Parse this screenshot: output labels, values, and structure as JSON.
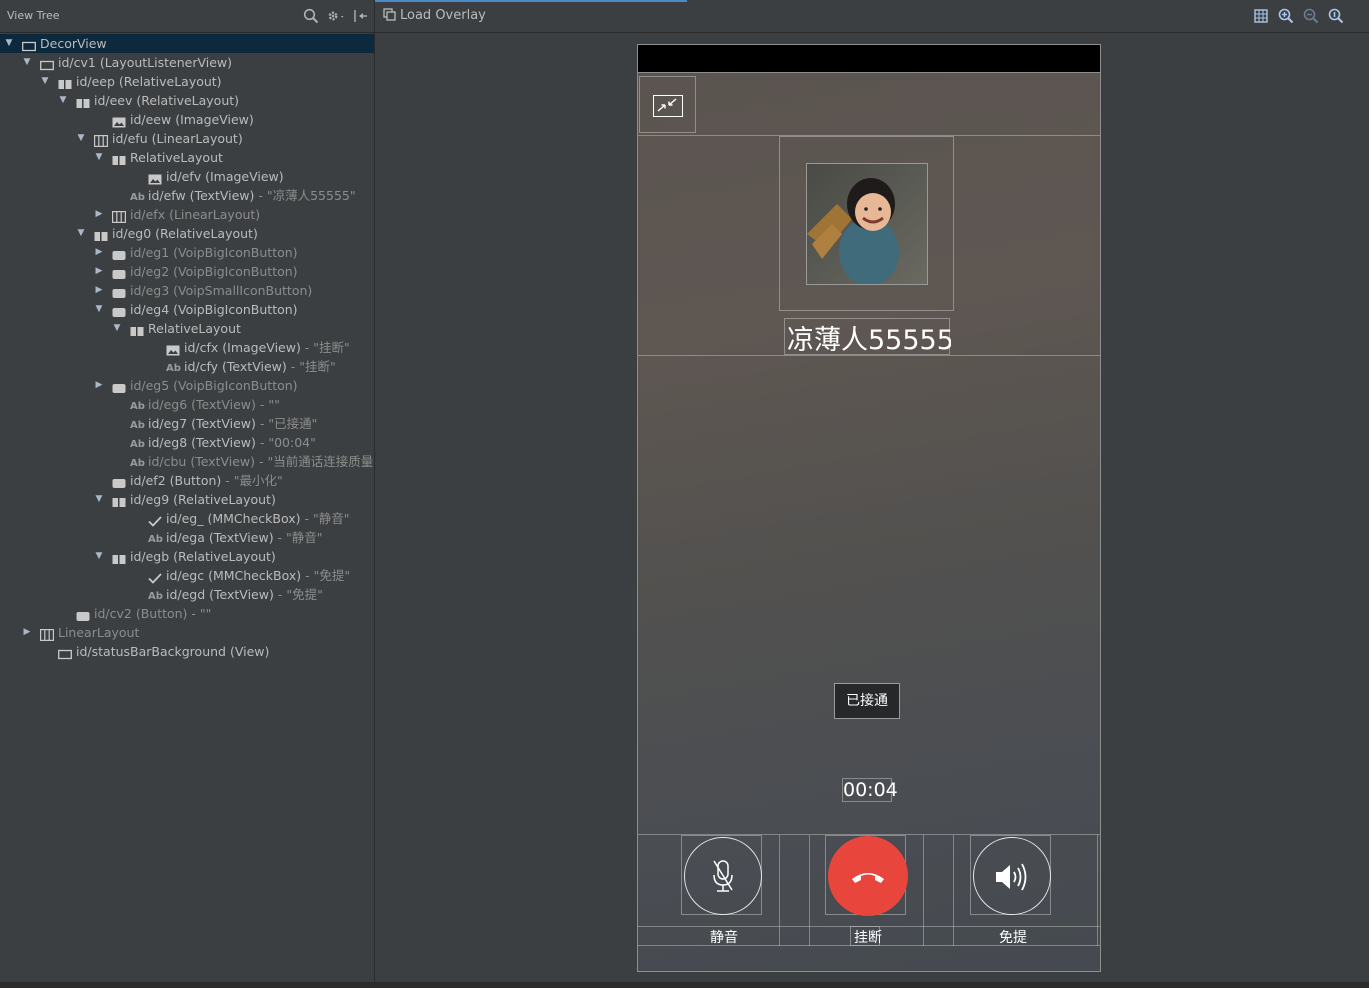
{
  "left_panel": {
    "title": "View Tree"
  },
  "tree": [
    {
      "indent": 0,
      "arrow": "down",
      "icon": "view-icon",
      "label": "DecorView",
      "value": "",
      "state": "sel"
    },
    {
      "indent": 1,
      "arrow": "down",
      "icon": "view-icon",
      "label": "id/cv1 (LayoutListenerView)",
      "value": "",
      "state": "on"
    },
    {
      "indent": 2,
      "arrow": "down",
      "icon": "relative-layout-icon",
      "label": "id/eep (RelativeLayout)",
      "value": "",
      "state": "on"
    },
    {
      "indent": 3,
      "arrow": "down",
      "icon": "relative-layout-icon",
      "label": "id/eev (RelativeLayout)",
      "value": "",
      "state": "on"
    },
    {
      "indent": 5,
      "arrow": "",
      "icon": "image-view-icon",
      "label": "id/eew (ImageView)",
      "value": "",
      "state": "on"
    },
    {
      "indent": 4,
      "arrow": "down",
      "icon": "linear-layout-icon",
      "label": "id/efu (LinearLayout)",
      "value": "",
      "state": "on"
    },
    {
      "indent": 5,
      "arrow": "down",
      "icon": "relative-layout-icon",
      "label": "RelativeLayout",
      "value": "",
      "state": "on"
    },
    {
      "indent": 7,
      "arrow": "",
      "icon": "image-view-icon",
      "label": "id/efv (ImageView)",
      "value": "",
      "state": "on"
    },
    {
      "indent": 6,
      "arrow": "",
      "icon": "text-view-icon",
      "label": "id/efw (TextView)",
      "value": " - \"凉薄人55555\"",
      "state": "on"
    },
    {
      "indent": 5,
      "arrow": "right",
      "icon": "linear-layout-icon",
      "label": "id/efx (LinearLayout)",
      "value": "",
      "state": "off"
    },
    {
      "indent": 4,
      "arrow": "down",
      "icon": "relative-layout-icon",
      "label": "id/eg0 (RelativeLayout)",
      "value": "",
      "state": "on"
    },
    {
      "indent": 5,
      "arrow": "right",
      "icon": "button-icon",
      "label": "id/eg1 (VoipBigIconButton)",
      "value": "",
      "state": "off"
    },
    {
      "indent": 5,
      "arrow": "right",
      "icon": "button-icon",
      "label": "id/eg2 (VoipBigIconButton)",
      "value": "",
      "state": "off"
    },
    {
      "indent": 5,
      "arrow": "right",
      "icon": "button-icon",
      "label": "id/eg3 (VoipSmallIconButton)",
      "value": "",
      "state": "off"
    },
    {
      "indent": 5,
      "arrow": "down",
      "icon": "button-icon",
      "label": "id/eg4 (VoipBigIconButton)",
      "value": "",
      "state": "on"
    },
    {
      "indent": 6,
      "arrow": "down",
      "icon": "relative-layout-icon",
      "label": "RelativeLayout",
      "value": "",
      "state": "on"
    },
    {
      "indent": 8,
      "arrow": "",
      "icon": "image-view-icon",
      "label": "id/cfx (ImageView)",
      "value": " - \"挂断\"",
      "state": "on"
    },
    {
      "indent": 8,
      "arrow": "",
      "icon": "text-view-icon",
      "label": "id/cfy (TextView)",
      "value": " - \"挂断\"",
      "state": "on"
    },
    {
      "indent": 5,
      "arrow": "right",
      "icon": "button-icon",
      "label": "id/eg5 (VoipBigIconButton)",
      "value": "",
      "state": "off"
    },
    {
      "indent": 6,
      "arrow": "",
      "icon": "text-view-icon",
      "label": "id/eg6 (TextView)",
      "value": " - \"\"",
      "state": "off"
    },
    {
      "indent": 6,
      "arrow": "",
      "icon": "text-view-icon",
      "label": "id/eg7 (TextView)",
      "value": " - \"已接通\"",
      "state": "on"
    },
    {
      "indent": 6,
      "arrow": "",
      "icon": "text-view-icon",
      "label": "id/eg8 (TextView)",
      "value": " - \"00:04\"",
      "state": "on"
    },
    {
      "indent": 6,
      "arrow": "",
      "icon": "text-view-icon",
      "label": "id/cbu (TextView)",
      "value": " - \"当前通话连接质量不",
      "state": "off"
    },
    {
      "indent": 5,
      "arrow": "",
      "icon": "button-icon",
      "label": "id/ef2 (Button)",
      "value": " - \"最小化\"",
      "state": "on"
    },
    {
      "indent": 5,
      "arrow": "down",
      "icon": "relative-layout-icon",
      "label": "id/eg9 (RelativeLayout)",
      "value": "",
      "state": "on"
    },
    {
      "indent": 7,
      "arrow": "",
      "icon": "check-icon",
      "label": "id/eg_ (MMCheckBox)",
      "value": " - \"静音\"",
      "state": "on"
    },
    {
      "indent": 7,
      "arrow": "",
      "icon": "text-view-icon",
      "label": "id/ega (TextView)",
      "value": " - \"静音\"",
      "state": "on"
    },
    {
      "indent": 5,
      "arrow": "down",
      "icon": "relative-layout-icon",
      "label": "id/egb (RelativeLayout)",
      "value": "",
      "state": "on"
    },
    {
      "indent": 7,
      "arrow": "",
      "icon": "check-icon",
      "label": "id/egc (MMCheckBox)",
      "value": " - \"免提\"",
      "state": "on"
    },
    {
      "indent": 7,
      "arrow": "",
      "icon": "text-view-icon",
      "label": "id/egd (TextView)",
      "value": " - \"免提\"",
      "state": "on"
    },
    {
      "indent": 3,
      "arrow": "",
      "icon": "button-icon",
      "label": "id/cv2 (Button)",
      "value": " - \"\"",
      "state": "off"
    },
    {
      "indent": 1,
      "arrow": "right",
      "icon": "linear-layout-icon",
      "label": "LinearLayout",
      "value": "",
      "state": "off"
    },
    {
      "indent": 2,
      "arrow": "",
      "icon": "view-icon",
      "label": "id/statusBarBackground (View)",
      "value": "",
      "state": "on"
    }
  ],
  "right_panel": {
    "load_overlay_label": "Load Overlay"
  },
  "phone": {
    "contact_name": "凉薄人55555",
    "call_status": "已接通",
    "call_timer": "00:04",
    "mute_label": "静音",
    "hangup_label": "挂断",
    "speaker_label": "免提"
  },
  "colors": {
    "selection": "#0d293e",
    "hangup_red": "#e8453c",
    "accent_blue": "#4a88c7"
  }
}
